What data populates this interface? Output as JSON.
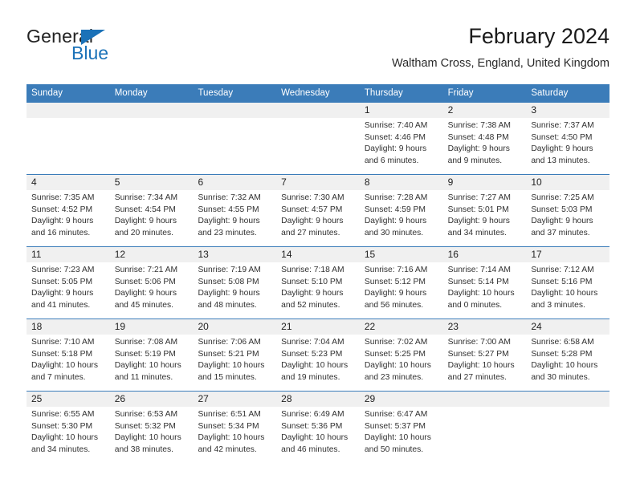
{
  "brand": {
    "name_dark": "General",
    "name_blue": "Blue",
    "triangle_color": "#1b72b8"
  },
  "header": {
    "title": "February 2024",
    "location": "Waltham Cross, England, United Kingdom"
  },
  "theme": {
    "header_blue": "#3b7cb9",
    "date_band_gray": "#f0f0f0",
    "text": "#303030"
  },
  "weekdays": [
    "Sunday",
    "Monday",
    "Tuesday",
    "Wednesday",
    "Thursday",
    "Friday",
    "Saturday"
  ],
  "labels": {
    "sunrise": "Sunrise:",
    "sunset": "Sunset:",
    "daylight": "Daylight:"
  },
  "weeks": [
    [
      {
        "day": "",
        "l1": "",
        "l2": "",
        "l3": "",
        "l4": ""
      },
      {
        "day": "",
        "l1": "",
        "l2": "",
        "l3": "",
        "l4": ""
      },
      {
        "day": "",
        "l1": "",
        "l2": "",
        "l3": "",
        "l4": ""
      },
      {
        "day": "",
        "l1": "",
        "l2": "",
        "l3": "",
        "l4": ""
      },
      {
        "day": "1",
        "l1": "Sunrise: 7:40 AM",
        "l2": "Sunset: 4:46 PM",
        "l3": "Daylight: 9 hours",
        "l4": "and 6 minutes."
      },
      {
        "day": "2",
        "l1": "Sunrise: 7:38 AM",
        "l2": "Sunset: 4:48 PM",
        "l3": "Daylight: 9 hours",
        "l4": "and 9 minutes."
      },
      {
        "day": "3",
        "l1": "Sunrise: 7:37 AM",
        "l2": "Sunset: 4:50 PM",
        "l3": "Daylight: 9 hours",
        "l4": "and 13 minutes."
      }
    ],
    [
      {
        "day": "4",
        "l1": "Sunrise: 7:35 AM",
        "l2": "Sunset: 4:52 PM",
        "l3": "Daylight: 9 hours",
        "l4": "and 16 minutes."
      },
      {
        "day": "5",
        "l1": "Sunrise: 7:34 AM",
        "l2": "Sunset: 4:54 PM",
        "l3": "Daylight: 9 hours",
        "l4": "and 20 minutes."
      },
      {
        "day": "6",
        "l1": "Sunrise: 7:32 AM",
        "l2": "Sunset: 4:55 PM",
        "l3": "Daylight: 9 hours",
        "l4": "and 23 minutes."
      },
      {
        "day": "7",
        "l1": "Sunrise: 7:30 AM",
        "l2": "Sunset: 4:57 PM",
        "l3": "Daylight: 9 hours",
        "l4": "and 27 minutes."
      },
      {
        "day": "8",
        "l1": "Sunrise: 7:28 AM",
        "l2": "Sunset: 4:59 PM",
        "l3": "Daylight: 9 hours",
        "l4": "and 30 minutes."
      },
      {
        "day": "9",
        "l1": "Sunrise: 7:27 AM",
        "l2": "Sunset: 5:01 PM",
        "l3": "Daylight: 9 hours",
        "l4": "and 34 minutes."
      },
      {
        "day": "10",
        "l1": "Sunrise: 7:25 AM",
        "l2": "Sunset: 5:03 PM",
        "l3": "Daylight: 9 hours",
        "l4": "and 37 minutes."
      }
    ],
    [
      {
        "day": "11",
        "l1": "Sunrise: 7:23 AM",
        "l2": "Sunset: 5:05 PM",
        "l3": "Daylight: 9 hours",
        "l4": "and 41 minutes."
      },
      {
        "day": "12",
        "l1": "Sunrise: 7:21 AM",
        "l2": "Sunset: 5:06 PM",
        "l3": "Daylight: 9 hours",
        "l4": "and 45 minutes."
      },
      {
        "day": "13",
        "l1": "Sunrise: 7:19 AM",
        "l2": "Sunset: 5:08 PM",
        "l3": "Daylight: 9 hours",
        "l4": "and 48 minutes."
      },
      {
        "day": "14",
        "l1": "Sunrise: 7:18 AM",
        "l2": "Sunset: 5:10 PM",
        "l3": "Daylight: 9 hours",
        "l4": "and 52 minutes."
      },
      {
        "day": "15",
        "l1": "Sunrise: 7:16 AM",
        "l2": "Sunset: 5:12 PM",
        "l3": "Daylight: 9 hours",
        "l4": "and 56 minutes."
      },
      {
        "day": "16",
        "l1": "Sunrise: 7:14 AM",
        "l2": "Sunset: 5:14 PM",
        "l3": "Daylight: 10 hours",
        "l4": "and 0 minutes."
      },
      {
        "day": "17",
        "l1": "Sunrise: 7:12 AM",
        "l2": "Sunset: 5:16 PM",
        "l3": "Daylight: 10 hours",
        "l4": "and 3 minutes."
      }
    ],
    [
      {
        "day": "18",
        "l1": "Sunrise: 7:10 AM",
        "l2": "Sunset: 5:18 PM",
        "l3": "Daylight: 10 hours",
        "l4": "and 7 minutes."
      },
      {
        "day": "19",
        "l1": "Sunrise: 7:08 AM",
        "l2": "Sunset: 5:19 PM",
        "l3": "Daylight: 10 hours",
        "l4": "and 11 minutes."
      },
      {
        "day": "20",
        "l1": "Sunrise: 7:06 AM",
        "l2": "Sunset: 5:21 PM",
        "l3": "Daylight: 10 hours",
        "l4": "and 15 minutes."
      },
      {
        "day": "21",
        "l1": "Sunrise: 7:04 AM",
        "l2": "Sunset: 5:23 PM",
        "l3": "Daylight: 10 hours",
        "l4": "and 19 minutes."
      },
      {
        "day": "22",
        "l1": "Sunrise: 7:02 AM",
        "l2": "Sunset: 5:25 PM",
        "l3": "Daylight: 10 hours",
        "l4": "and 23 minutes."
      },
      {
        "day": "23",
        "l1": "Sunrise: 7:00 AM",
        "l2": "Sunset: 5:27 PM",
        "l3": "Daylight: 10 hours",
        "l4": "and 27 minutes."
      },
      {
        "day": "24",
        "l1": "Sunrise: 6:58 AM",
        "l2": "Sunset: 5:28 PM",
        "l3": "Daylight: 10 hours",
        "l4": "and 30 minutes."
      }
    ],
    [
      {
        "day": "25",
        "l1": "Sunrise: 6:55 AM",
        "l2": "Sunset: 5:30 PM",
        "l3": "Daylight: 10 hours",
        "l4": "and 34 minutes."
      },
      {
        "day": "26",
        "l1": "Sunrise: 6:53 AM",
        "l2": "Sunset: 5:32 PM",
        "l3": "Daylight: 10 hours",
        "l4": "and 38 minutes."
      },
      {
        "day": "27",
        "l1": "Sunrise: 6:51 AM",
        "l2": "Sunset: 5:34 PM",
        "l3": "Daylight: 10 hours",
        "l4": "and 42 minutes."
      },
      {
        "day": "28",
        "l1": "Sunrise: 6:49 AM",
        "l2": "Sunset: 5:36 PM",
        "l3": "Daylight: 10 hours",
        "l4": "and 46 minutes."
      },
      {
        "day": "29",
        "l1": "Sunrise: 6:47 AM",
        "l2": "Sunset: 5:37 PM",
        "l3": "Daylight: 10 hours",
        "l4": "and 50 minutes."
      },
      {
        "day": "",
        "l1": "",
        "l2": "",
        "l3": "",
        "l4": ""
      },
      {
        "day": "",
        "l1": "",
        "l2": "",
        "l3": "",
        "l4": ""
      }
    ]
  ]
}
